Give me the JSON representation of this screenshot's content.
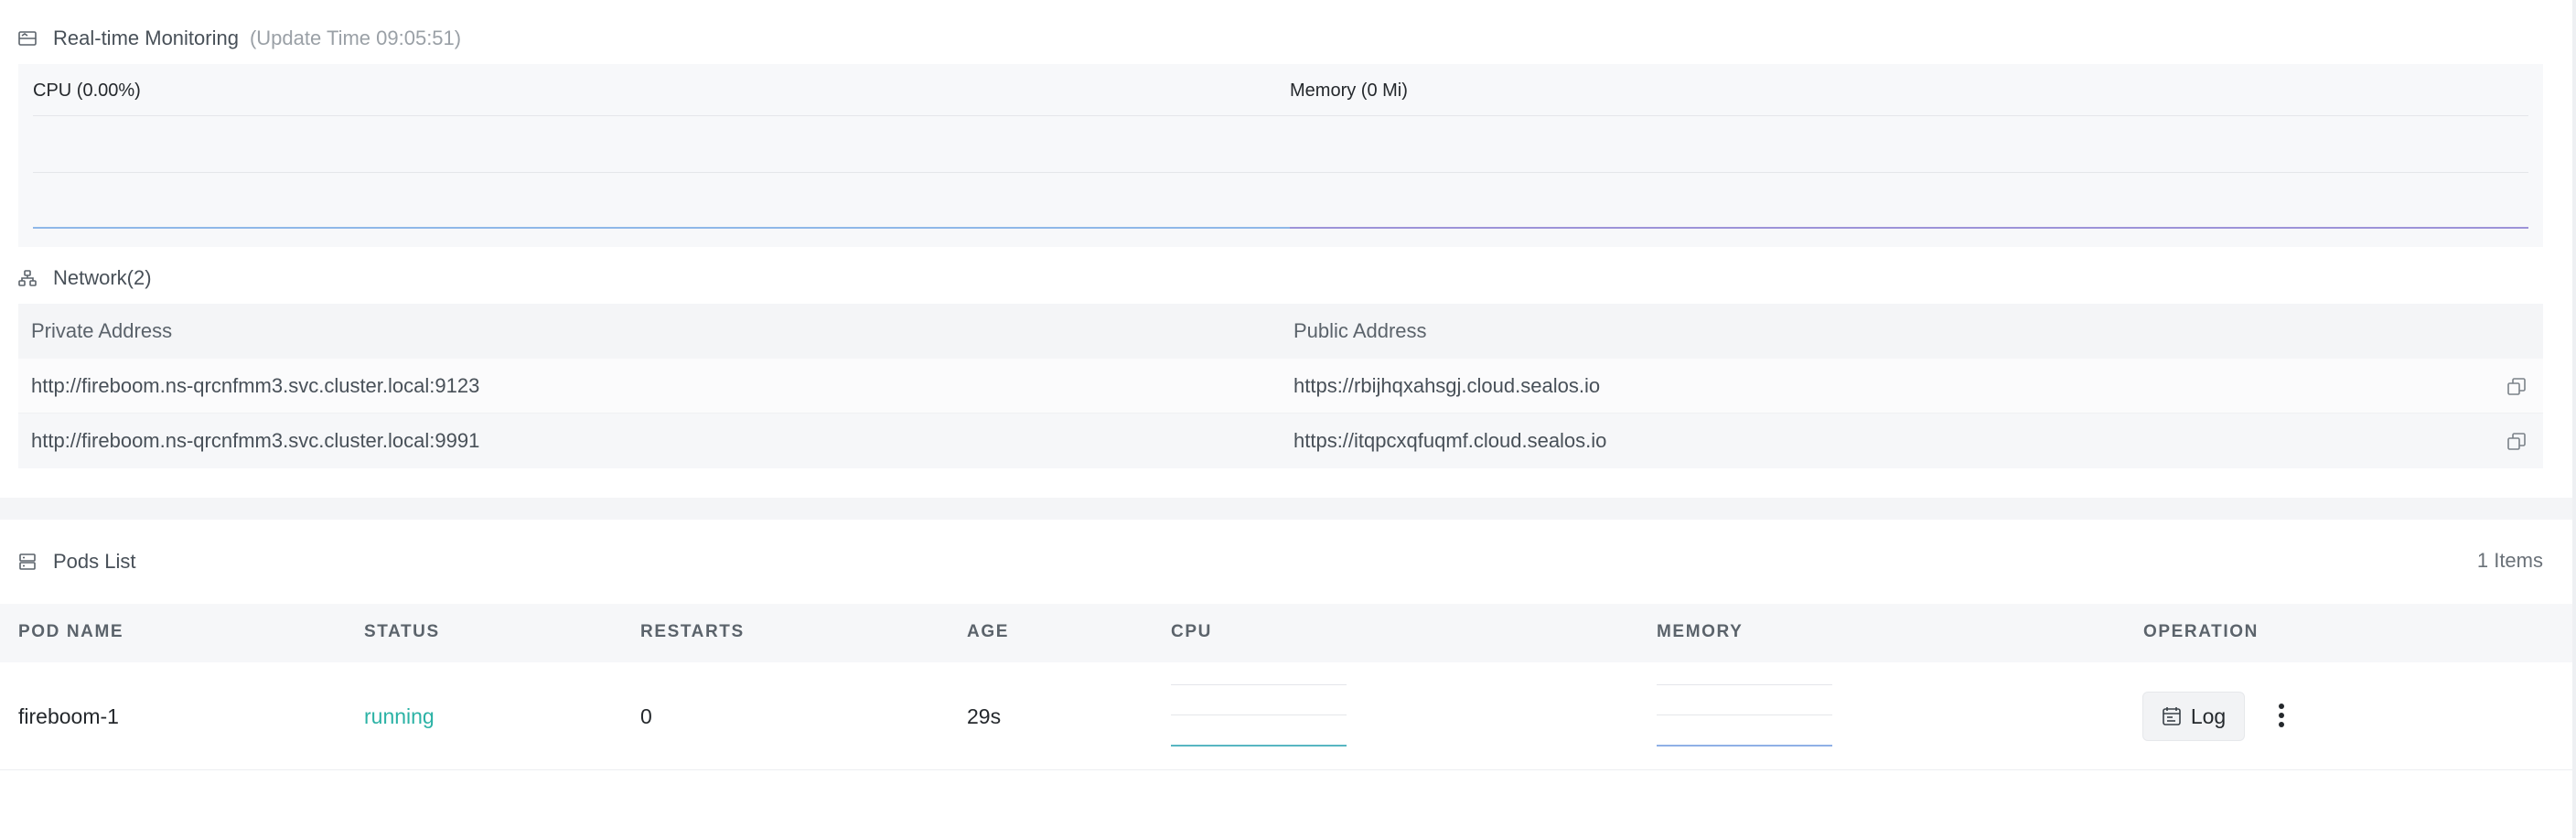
{
  "monitoring": {
    "title": "Real-time Monitoring",
    "update_text": "(Update Time  09:05:51)",
    "cpu": {
      "label": "CPU  (0.00%)",
      "value_percent": 0.0,
      "line_color": "#8fb8e8"
    },
    "memory": {
      "label": "Memory  (0 Mi)",
      "value_mi": 0,
      "line_color": "#9d93d8"
    }
  },
  "network": {
    "title": "Network(2)",
    "columns": [
      "Private Address",
      "Public Address"
    ],
    "rows": [
      {
        "private": "http://fireboom.ns-qrcnfmm3.svc.cluster.local:9123",
        "public": "https://rbijhqxahsgj.cloud.sealos.io"
      },
      {
        "private": "http://fireboom.ns-qrcnfmm3.svc.cluster.local:9991",
        "public": "https://itqpcxqfuqmf.cloud.sealos.io"
      }
    ]
  },
  "pods": {
    "title": "Pods List",
    "count_text": "1 Items",
    "columns": [
      "POD NAME",
      "STATUS",
      "RESTARTS",
      "AGE",
      "CPU",
      "MEMORY",
      "OPERATION"
    ],
    "rows": [
      {
        "name": "fireboom-1",
        "status": "running",
        "restarts": "0",
        "age": "29s",
        "cpu_line_color": "#57b6c2",
        "memory_line_color": "#8fb0e6",
        "log_label": "Log"
      }
    ],
    "status_color": "#2bb2a5"
  },
  "icons": {
    "monitoring": "monitor-icon",
    "network": "network-icon",
    "pods": "list-icon",
    "copy": "copy-icon",
    "log": "log-icon",
    "more": "more-vertical-icon"
  }
}
